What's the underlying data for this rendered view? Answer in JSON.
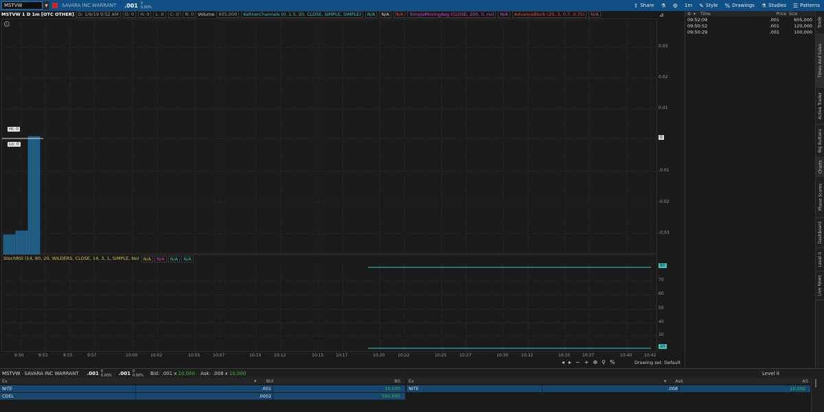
{
  "topbar": {
    "symbol": "MSTVW",
    "company": "SAVARA INC WARRANT",
    "price": ".001",
    "change": "0",
    "change_pct": "0.00%",
    "timeframe": "1m",
    "share": "Share",
    "style": "Style",
    "drawings": "Drawings",
    "studies": "Studies",
    "patterns": "Patterns"
  },
  "chart_info": {
    "symbol": "MSTVW 1 D 1m [OTC OTHER]",
    "date": "D: 1/9/19 9:52 AM",
    "open": "O: 0",
    "high": "H: 0",
    "low": "L: 0",
    "close": "C: 0",
    "range": "R: 0",
    "volume_label": "Volume",
    "volume": "605,000",
    "keltner": "KeltnerChannels (0, 1.5, 20, CLOSE, SIMPLE, SIMPLE)",
    "na": "N/A",
    "sma": "SimpleMovingAvg (CLOSE, 200, 0, no)",
    "advance": "AdvanceBlock (20, 3, 0.7, 0.75)"
  },
  "price_pane": {
    "y_ticks": [
      "0.03",
      "0.02",
      "0.01",
      "0",
      "-0.01",
      "-0.02",
      "-0.03"
    ],
    "hi_label": "Hi: 0",
    "lo_label": "Lo: 0",
    "price_marker": "0"
  },
  "stoch_pane": {
    "label": "StochRSI (14, 80, 20, WILDERS, CLOSE, 14, 3, 1, SIMPLE, No)",
    "y_ticks": [
      "70",
      "60",
      "50",
      "40",
      "30"
    ],
    "upper_marker": "80",
    "lower_marker": "20"
  },
  "x_ticks": [
    "9:50",
    "9:53",
    "9:55",
    "9:57",
    "10:00",
    "10:02",
    "10:05",
    "10:07",
    "10:10",
    "10:12",
    "10:15",
    "10:17",
    "10:20",
    "10:22",
    "10:25",
    "10:27",
    "10:30",
    "10:32",
    "10:35",
    "10:37",
    "10:40",
    "10:42"
  ],
  "drawing_set": "Drawing set: Default",
  "times_sales": {
    "headers": [
      "Time",
      "Price",
      "Size"
    ],
    "rows": [
      {
        "time": "09:52:09",
        "price": ".001",
        "size": "605,000"
      },
      {
        "time": "09:50:52",
        "price": ".001",
        "size": "120,000"
      },
      {
        "time": "09:50:29",
        "price": ".001",
        "size": "100,000"
      }
    ]
  },
  "vertical_tabs": [
    "Trade",
    "Times And Sales",
    "Active Trader",
    "Big Buttons",
    "Charts",
    "Phase Scores",
    "Dashboard",
    "Level II",
    "Live News"
  ],
  "level2": {
    "symbol": "MSTVW",
    "company": "SAVARA INC WARRANT",
    "price1": ".001",
    "price2": ".001",
    "chg": "0",
    "chg_pct": "0.00%",
    "bid_label": "Bid:",
    "bid": ".001 x",
    "bid_size": "10,000",
    "ask_label": "Ask:",
    "ask": ".008 x",
    "ask_size": "10,000",
    "title": "Level II",
    "bid_headers": [
      "Ex",
      "Bid",
      "BS"
    ],
    "ask_headers": [
      "Ex",
      "Ask",
      "AS"
    ],
    "bids": [
      {
        "ex": "NITE",
        "price": ".001",
        "size": "10,000"
      },
      {
        "ex": "CDEL",
        "price": ".0002",
        "size": "500,000"
      }
    ],
    "asks": [
      {
        "ex": "NITE",
        "price": ".008",
        "size": "10,000"
      }
    ]
  },
  "colors": {
    "topbar": "#0f4f85",
    "bar_fill": "#1f5d82",
    "stoch_line": "#3fc7c7",
    "bid_row": "#17476f",
    "size_green": "#3fbf3f"
  },
  "chart_data": {
    "type": "bar",
    "title": "",
    "categories": [
      "9:50",
      "9:51",
      "9:52"
    ],
    "series": [
      {
        "values": [
          0,
          0,
          0
        ]
      }
    ],
    "ylim": [
      -0.035,
      0.035
    ],
    "note_volume": [
      100000,
      120000,
      605000
    ]
  }
}
